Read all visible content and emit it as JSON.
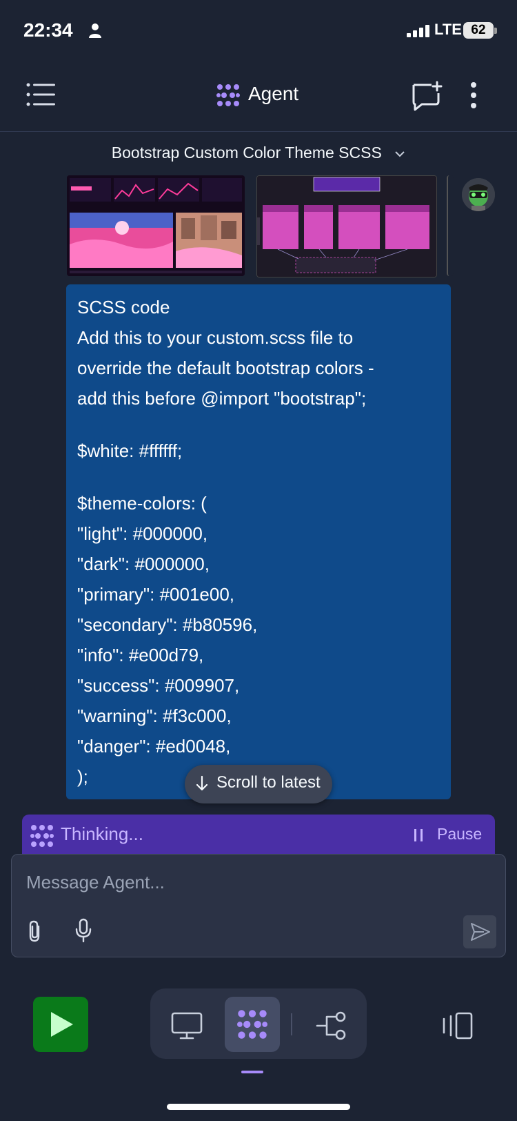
{
  "status_bar": {
    "time": "22:34",
    "network": "LTE",
    "battery": "62"
  },
  "header": {
    "title": "Agent"
  },
  "thread": {
    "title": "Bootstrap Custom Color Theme SCSS"
  },
  "message": {
    "lines": [
      "SCSS code",
      "Add this to your custom.scss file to",
      "override the default bootstrap colors -",
      "add this before @import \"bootstrap\";",
      "",
      "$white: #ffffff;",
      "",
      "$theme-colors: (",
      "\"light\": #000000,",
      "\"dark\": #000000,",
      "\"primary\": #001e00,",
      "\"secondary\": #b80596,",
      "\"info\": #e00d79,",
      "\"success\": #009907,",
      "\"warning\": #f3c000,",
      "\"danger\": #ed0048,",
      ");"
    ]
  },
  "scroll_button": {
    "label": "Scroll to latest"
  },
  "thinking": {
    "label": "Thinking...",
    "pause_label": "Pause"
  },
  "input": {
    "placeholder": "Message Agent..."
  },
  "colors": {
    "background": "#1c2333",
    "bubble": "#0f4a8a",
    "accent": "#a78bfa",
    "thinking_bar": "#4a2fa6",
    "run_button": "#0a7a1a"
  },
  "icons": [
    "person-icon",
    "signal-icon",
    "menu-icon",
    "agent-logo-icon",
    "new-chat-icon",
    "more-icon",
    "chevron-down-icon",
    "pause-icon",
    "paperclip-icon",
    "microphone-icon",
    "send-icon",
    "play-icon",
    "monitor-icon",
    "agent-icon",
    "workflow-icon",
    "panels-icon"
  ]
}
